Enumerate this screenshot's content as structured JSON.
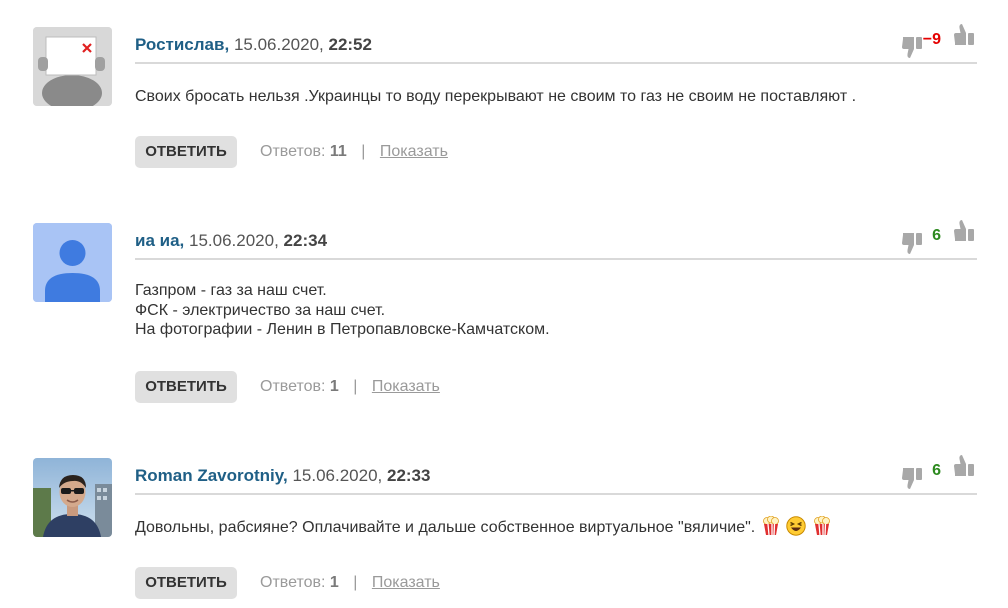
{
  "comments": [
    {
      "author": "Ростислав,",
      "date": "15.06.2020,",
      "time": "22:52",
      "score": "−9",
      "score_type": "negative",
      "lines": [
        "Своих бросать нельзя .Украинцы то воду перекрывают не своим то газ не своим не поставляют ."
      ],
      "reply_label": "ОТВЕТИТЬ",
      "replies_label": "Ответов:",
      "replies_count": "11",
      "separator": "|",
      "show_label": "Показать"
    },
    {
      "author": "иа иа,",
      "date": "15.06.2020,",
      "time": "22:34",
      "score": "6",
      "score_type": "positive",
      "lines": [
        "Газпром - газ за наш счет.",
        "ФСК - электричество за наш счет.",
        "На фотографии - Ленин в Петропавловске-Камчатском."
      ],
      "reply_label": "ОТВЕТИТЬ",
      "replies_label": "Ответов:",
      "replies_count": "1",
      "separator": "|",
      "show_label": "Показать"
    },
    {
      "author": "Roman Zavorotniy,",
      "date": "15.06.2020,",
      "time": "22:33",
      "score": "6",
      "score_type": "positive",
      "lines": [
        "Довольны, рабсияне? Оплачивайте и дальше собственное виртуальное \"вяличие\"."
      ],
      "reply_label": "ОТВЕТИТЬ",
      "replies_label": "Ответов:",
      "replies_count": "1",
      "separator": "|",
      "show_label": "Показать"
    }
  ],
  "colors": {
    "author": "#1f5f86",
    "negative": "#e40000",
    "positive": "#2d8a1f",
    "button_bg": "#e0e0e0",
    "divider": "#d9d9d9",
    "vote_icon": "#a8a8a8"
  },
  "icons": [
    "thumb-down-icon",
    "thumb-up-icon",
    "broken-image-avatar",
    "default-user-avatar",
    "photo-avatar",
    "popcorn-emoji",
    "laughing-emoji"
  ]
}
